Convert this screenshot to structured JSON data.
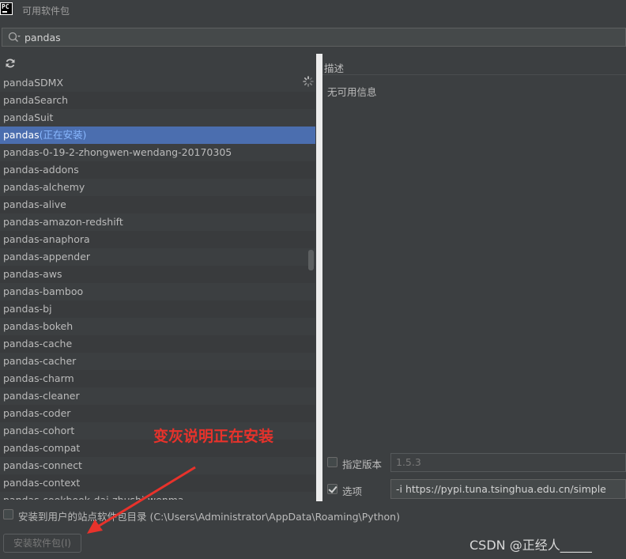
{
  "window": {
    "title": "可用软件包",
    "logo": "PC"
  },
  "search": {
    "value": "pandas",
    "icon": "search-icon"
  },
  "packages": [
    {
      "name": "pandaSDMX"
    },
    {
      "name": "pandaSearch"
    },
    {
      "name": "pandaSuit"
    },
    {
      "name": "pandas",
      "status": "(正在安装)",
      "selected": true
    },
    {
      "name": "pandas-0-19-2-zhongwen-wendang-20170305"
    },
    {
      "name": "pandas-addons"
    },
    {
      "name": "pandas-alchemy"
    },
    {
      "name": "pandas-alive"
    },
    {
      "name": "pandas-amazon-redshift"
    },
    {
      "name": "pandas-anaphora"
    },
    {
      "name": "pandas-appender"
    },
    {
      "name": "pandas-aws"
    },
    {
      "name": "pandas-bamboo"
    },
    {
      "name": "pandas-bj"
    },
    {
      "name": "pandas-bokeh"
    },
    {
      "name": "pandas-cache"
    },
    {
      "name": "pandas-cacher"
    },
    {
      "name": "pandas-charm"
    },
    {
      "name": "pandas-cleaner"
    },
    {
      "name": "pandas-coder"
    },
    {
      "name": "pandas-cohort"
    },
    {
      "name": "pandas-compat"
    },
    {
      "name": "pandas-connect"
    },
    {
      "name": "pandas-context"
    },
    {
      "name": "pandas-cookbook-dai-zhushi-wenma"
    }
  ],
  "description": {
    "label": "描述",
    "text": "无可用信息"
  },
  "version": {
    "label": "指定版本",
    "value": "1.5.3",
    "checked": false
  },
  "options": {
    "label": "选项",
    "value": "-i https://pypi.tuna.tsinghua.edu.cn/simple",
    "checked": true
  },
  "user_site": {
    "label": "安装到用户的站点软件包目录 (C:\\Users\\Administrator\\AppData\\Roaming\\Python)",
    "checked": false
  },
  "install_button": {
    "label": "安装软件包(I)"
  },
  "annotation": {
    "text": "变灰说明正在安装",
    "color": "#e8322b"
  },
  "watermark": "CSDN @正经人_____",
  "colors": {
    "selection": "#4b6eaf",
    "background": "#3c3f41",
    "status": "#89b8ff"
  }
}
